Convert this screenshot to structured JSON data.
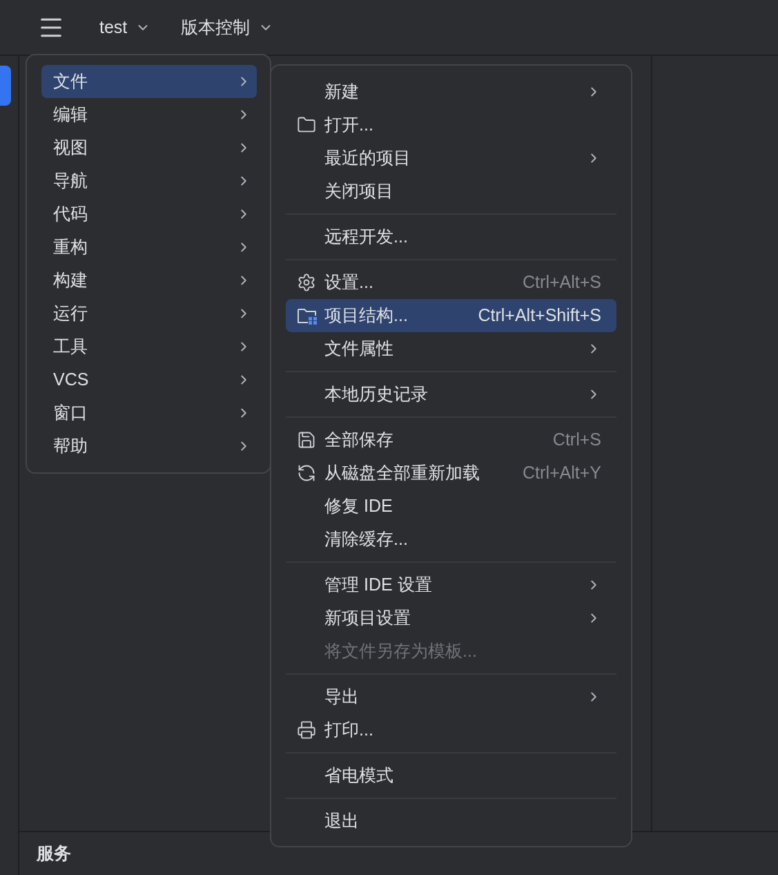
{
  "toolbar": {
    "project": "test",
    "vcs": "版本控制"
  },
  "main_menu": [
    {
      "label": "文件",
      "selected": true
    },
    {
      "label": "编辑",
      "selected": false
    },
    {
      "label": "视图",
      "selected": false
    },
    {
      "label": "导航",
      "selected": false
    },
    {
      "label": "代码",
      "selected": false
    },
    {
      "label": "重构",
      "selected": false
    },
    {
      "label": "构建",
      "selected": false
    },
    {
      "label": "运行",
      "selected": false
    },
    {
      "label": "工具",
      "selected": false
    },
    {
      "label": "VCS",
      "selected": false
    },
    {
      "label": "窗口",
      "selected": false
    },
    {
      "label": "帮助",
      "selected": false
    }
  ],
  "file_menu": {
    "groups": [
      [
        {
          "label": "新建",
          "submenu": true,
          "selected": false,
          "disabled": false
        },
        {
          "label": "打开...",
          "kind": "folder",
          "submenu": false,
          "selected": false,
          "disabled": false
        },
        {
          "label": "最近的项目",
          "submenu": true,
          "selected": false,
          "disabled": false
        },
        {
          "label": "关闭项目",
          "submenu": false,
          "selected": false,
          "disabled": false
        }
      ],
      [
        {
          "label": "远程开发...",
          "submenu": false,
          "selected": false,
          "disabled": false
        }
      ],
      [
        {
          "label": "设置...",
          "kind": "settings",
          "shortcut": "Ctrl+Alt+S",
          "submenu": false,
          "selected": false,
          "disabled": false
        },
        {
          "label": "项目结构...",
          "kind": "project-structure",
          "shortcut": "Ctrl+Alt+Shift+S",
          "submenu": false,
          "selected": true,
          "disabled": false
        },
        {
          "label": "文件属性",
          "submenu": true,
          "selected": false,
          "disabled": false
        }
      ],
      [
        {
          "label": "本地历史记录",
          "submenu": true,
          "selected": false,
          "disabled": false
        }
      ],
      [
        {
          "label": "全部保存",
          "kind": "save",
          "shortcut": "Ctrl+S",
          "submenu": false,
          "selected": false,
          "disabled": false
        },
        {
          "label": "从磁盘全部重新加载",
          "kind": "reload",
          "shortcut": "Ctrl+Alt+Y",
          "submenu": false,
          "selected": false,
          "disabled": false
        },
        {
          "label": "修复 IDE",
          "submenu": false,
          "selected": false,
          "disabled": false
        },
        {
          "label": "清除缓存...",
          "submenu": false,
          "selected": false,
          "disabled": false
        }
      ],
      [
        {
          "label": "管理 IDE 设置",
          "submenu": true,
          "selected": false,
          "disabled": false
        },
        {
          "label": "新项目设置",
          "submenu": true,
          "selected": false,
          "disabled": false
        },
        {
          "label": "将文件另存为模板...",
          "submenu": false,
          "selected": false,
          "disabled": true
        }
      ],
      [
        {
          "label": "导出",
          "submenu": true,
          "selected": false,
          "disabled": false
        },
        {
          "label": "打印...",
          "kind": "print",
          "submenu": false,
          "selected": false,
          "disabled": false
        }
      ],
      [
        {
          "label": "省电模式",
          "submenu": false,
          "selected": false,
          "disabled": false
        }
      ],
      [
        {
          "label": "退出",
          "submenu": false,
          "selected": false,
          "disabled": false
        }
      ]
    ]
  },
  "bottom_panel": {
    "title": "服务"
  }
}
